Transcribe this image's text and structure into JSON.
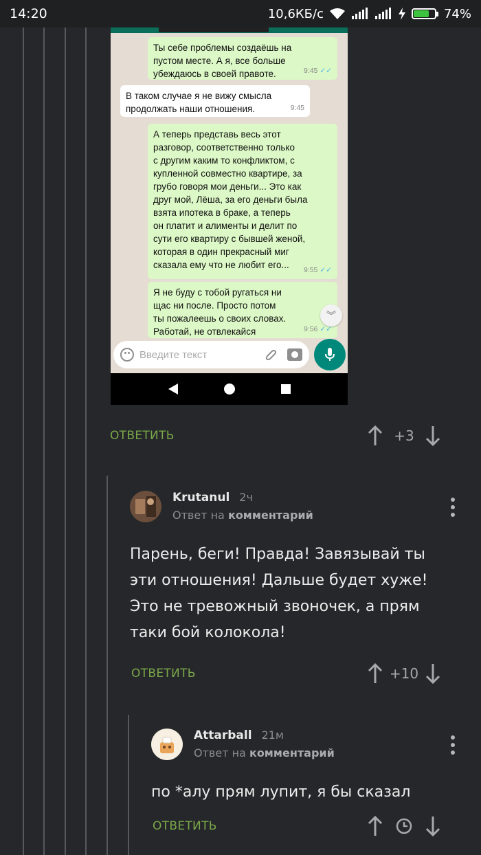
{
  "status_bar": {
    "time": "14:20",
    "speed": "10,6КБ/с",
    "battery": "74%",
    "battery_level": 0.74
  },
  "screenshot": {
    "messages": [
      {
        "dir": "out",
        "text": "Ты себе проблемы создаёшь на\nпустом месте. А я, все больше\nубеждаюсь в своей правоте.",
        "time": "9:45"
      },
      {
        "dir": "in",
        "text": "В таком случае я не вижу смысла\nпродолжать наши отношения.",
        "time": "9:45"
      },
      {
        "dir": "out",
        "text": "А теперь представь весь этот\nразговор, соответственно только\nс другим каким то конфликтом, с\nкупленной совместно квартире, за\nгрубо говоря мои деньги... Это как\nдруг мой, Лёша, за его деньги была\nвзята ипотека в браке, а теперь\nон платит и алименты и делит по\nсути его квартиру с бывшей женой,\nкоторая в один прекрасный миг\nсказала ему что не любит его...",
        "time": "9:55"
      },
      {
        "dir": "out",
        "text": "Я не буду с тобой ругаться ни\nщас ни после. Просто потом\nты пожалеешь о своих словах.\nРаботай, не отвлекайся",
        "time": "9:56"
      }
    ],
    "input_placeholder": "Введите текст"
  },
  "actions": [
    {
      "reply": "ОТВЕТИТЬ",
      "score": "+3"
    },
    {
      "reply": "ОТВЕТИТЬ",
      "score": "+10"
    },
    {
      "reply": "ОТВЕТИТЬ",
      "score": ""
    }
  ],
  "comments": [
    {
      "author": "Krutanul",
      "time": "2ч",
      "reply_prefix": "Ответ на",
      "reply_target": "комментарий",
      "text": "Парень, беги! Правда! Завязывай ты\nэти отношения! Дальше будет хуже!\nЭто не тревожный звоночек, а прям\nтаки бой колокола!"
    },
    {
      "author": "Attarball",
      "time": "21м",
      "reply_prefix": "Ответ на",
      "reply_target": "комментарий",
      "text": "по *алу прям лупит, я бы сказал"
    }
  ]
}
